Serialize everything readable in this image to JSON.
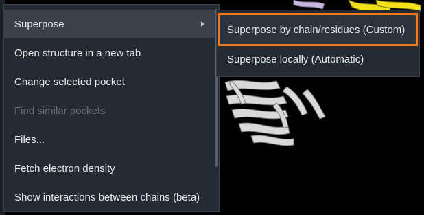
{
  "context_menu": {
    "items": [
      {
        "label": "Superpose"
      },
      {
        "label": "Open structure in a new tab"
      },
      {
        "label": "Change selected pocket"
      },
      {
        "label": "Find similar pockets"
      },
      {
        "label": "Files..."
      },
      {
        "label": "Fetch electron density"
      },
      {
        "label": "Show interactions between chains (beta)"
      }
    ]
  },
  "submenu": {
    "items": [
      {
        "label": "Superpose by chain/residues (Custom)"
      },
      {
        "label": "Superpose locally (Automatic)"
      }
    ]
  },
  "colors": {
    "menu_bg": "#262b33",
    "highlight_outline": "#f07a1a",
    "protein_white": "#d9d9d9",
    "protein_yellow": "#f2e11a",
    "protein_lavender": "#c8b8e0"
  }
}
